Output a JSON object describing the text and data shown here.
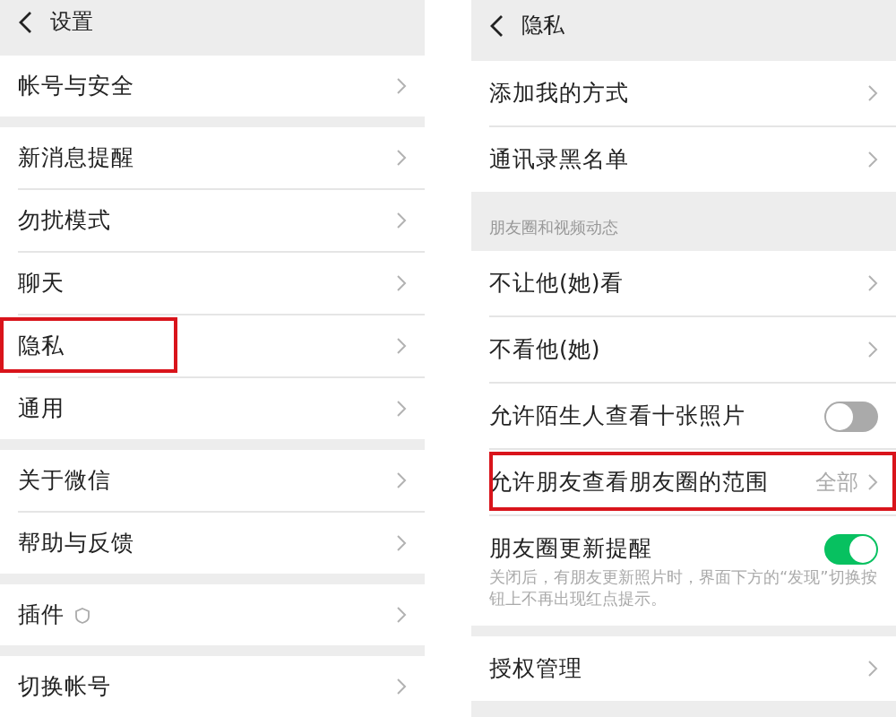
{
  "screens": [
    {
      "title": "设置",
      "groups": [
        {
          "items": [
            {
              "label": "帐号与安全",
              "kind": "link"
            }
          ]
        },
        {
          "items": [
            {
              "label": "新消息提醒",
              "kind": "link"
            },
            {
              "label": "勿扰模式",
              "kind": "link"
            },
            {
              "label": "聊天",
              "kind": "link"
            },
            {
              "label": "隐私",
              "kind": "link",
              "highlighted": true
            },
            {
              "label": "通用",
              "kind": "link"
            }
          ]
        },
        {
          "items": [
            {
              "label": "关于微信",
              "kind": "link"
            },
            {
              "label": "帮助与反馈",
              "kind": "link"
            }
          ]
        },
        {
          "items": [
            {
              "label": "插件",
              "kind": "link",
              "has_icon": true
            }
          ]
        },
        {
          "items": [
            {
              "label": "切换帐号",
              "kind": "link"
            }
          ]
        }
      ]
    },
    {
      "title": "隐私",
      "groups": [
        {
          "items": [
            {
              "label": "添加我的方式",
              "kind": "link"
            },
            {
              "label": "通讯录黑名单",
              "kind": "link"
            }
          ]
        },
        {
          "header": "朋友圈和视频动态",
          "items": [
            {
              "label": "不让他(她)看",
              "kind": "link"
            },
            {
              "label": "不看他(她)",
              "kind": "link"
            },
            {
              "label": "允许陌生人查看十张照片",
              "kind": "toggle",
              "on": false
            },
            {
              "label": "允许朋友查看朋友圈的范围",
              "kind": "link",
              "value": "全部",
              "highlighted": true
            },
            {
              "label": "朋友圈更新提醒",
              "kind": "toggle",
              "on": true,
              "note": "关闭后，有朋友更新照片时，界面下方的“发现”切换按钮上不再出现红点提示。"
            }
          ]
        },
        {
          "items": [
            {
              "label": "授权管理",
              "kind": "link"
            }
          ]
        }
      ]
    }
  ]
}
